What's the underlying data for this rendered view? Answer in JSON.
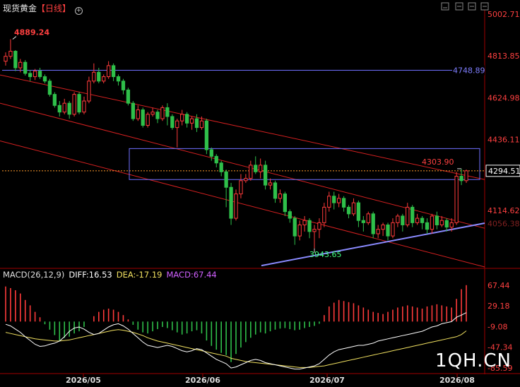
{
  "header": {
    "title": "现货黄金",
    "timeframe": "【日线】",
    "settings_icon": "circle-plus-icon",
    "window_buttons": [
      "minimize-icon",
      "restore-icon",
      "maximize-icon",
      "settings-circle-icon"
    ]
  },
  "colors": {
    "up": "#ff3b3b",
    "down": "#2fbf4a",
    "channel": "#d42020",
    "box": "#6f6fff",
    "support": "#8a8aff",
    "current": "#ff9a2a",
    "diff": "#ffffff",
    "dea": "#f0e060",
    "macd": "#c040ff"
  },
  "price_axis": {
    "ticks": [
      "5002.71",
      "4813.85",
      "4624.98",
      "4436.11",
      "4114.62"
    ],
    "hidden_tick": "4056.38",
    "current_value": "4294.51",
    "level_label": "4748.89"
  },
  "annotations": {
    "high": "4889.24",
    "low": "3943.65",
    "recent_high": "4303.90"
  },
  "x_axis": {
    "labels": [
      "2026/05",
      "2026/06",
      "2026/07",
      "2026/08"
    ]
  },
  "macd": {
    "name": "MACD(26,12,9)",
    "diff_label": "DIFF:16.53",
    "dea_label": "DEA:-17.19",
    "macd_label": "MACD:67.44",
    "ticks": [
      "67.44",
      "29.18",
      "-9.08",
      "-47.34",
      "-85.59"
    ]
  },
  "watermark": "1QH.CN",
  "chart_data": {
    "type": "candlestick",
    "title": "现货黄金【日线】",
    "ylim": [
      3860,
      5002.71
    ],
    "candles": [
      [
        4790,
        4812,
        4770,
        4830
      ],
      [
        4812,
        4835,
        4800,
        4889.24
      ],
      [
        4835,
        4760,
        4745,
        4840
      ],
      [
        4760,
        4785,
        4740,
        4800
      ],
      [
        4785,
        4735,
        4725,
        4795
      ],
      [
        4735,
        4720,
        4700,
        4750
      ],
      [
        4720,
        4745,
        4705,
        4755
      ],
      [
        4745,
        4720,
        4710,
        4760
      ],
      [
        4720,
        4700,
        4690,
        4730
      ],
      [
        4700,
        4640,
        4630,
        4710
      ],
      [
        4640,
        4590,
        4580,
        4650
      ],
      [
        4590,
        4560,
        4540,
        4610
      ],
      [
        4560,
        4600,
        4550,
        4620
      ],
      [
        4600,
        4550,
        4530,
        4610
      ],
      [
        4550,
        4640,
        4540,
        4650
      ],
      [
        4640,
        4560,
        4550,
        4650
      ],
      [
        4560,
        4610,
        4550,
        4630
      ],
      [
        4610,
        4700,
        4600,
        4720
      ],
      [
        4700,
        4740,
        4690,
        4780
      ],
      [
        4740,
        4700,
        4690,
        4760
      ],
      [
        4700,
        4720,
        4690,
        4730
      ],
      [
        4720,
        4770,
        4710,
        4790
      ],
      [
        4770,
        4720,
        4700,
        4780
      ],
      [
        4720,
        4700,
        4680,
        4730
      ],
      [
        4700,
        4660,
        4640,
        4710
      ],
      [
        4660,
        4600,
        4590,
        4670
      ],
      [
        4600,
        4530,
        4520,
        4610
      ],
      [
        4530,
        4570,
        4520,
        4590
      ],
      [
        4570,
        4500,
        4490,
        4580
      ],
      [
        4500,
        4550,
        4490,
        4560
      ],
      [
        4550,
        4560,
        4540,
        4580
      ],
      [
        4560,
        4530,
        4510,
        4570
      ],
      [
        4530,
        4580,
        4520,
        4590
      ],
      [
        4580,
        4540,
        4500,
        4600
      ],
      [
        4540,
        4490,
        4480,
        4550
      ],
      [
        4490,
        4520,
        4400,
        4530
      ],
      [
        4520,
        4550,
        4500,
        4570
      ],
      [
        4550,
        4510,
        4490,
        4560
      ],
      [
        4510,
        4530,
        4480,
        4540
      ],
      [
        4530,
        4490,
        4470,
        4550
      ],
      [
        4490,
        4520,
        4480,
        4540
      ],
      [
        4520,
        4390,
        4370,
        4530
      ],
      [
        4390,
        4360,
        4340,
        4400
      ],
      [
        4360,
        4330,
        4310,
        4370
      ],
      [
        4330,
        4290,
        4270,
        4340
      ],
      [
        4290,
        4220,
        4130,
        4300
      ],
      [
        4220,
        4080,
        4050,
        4240
      ],
      [
        4080,
        4190,
        4070,
        4210
      ],
      [
        4190,
        4250,
        4170,
        4280
      ],
      [
        4250,
        4260,
        4240,
        4280
      ],
      [
        4260,
        4320,
        4250,
        4340
      ],
      [
        4320,
        4290,
        4280,
        4360
      ],
      [
        4290,
        4320,
        4260,
        4350
      ],
      [
        4320,
        4230,
        4210,
        4340
      ],
      [
        4230,
        4240,
        4210,
        4260
      ],
      [
        4240,
        4170,
        4150,
        4250
      ],
      [
        4170,
        4190,
        4150,
        4210
      ],
      [
        4190,
        4110,
        4090,
        4200
      ],
      [
        4110,
        4080,
        4060,
        4120
      ],
      [
        4080,
        4000,
        3960,
        4090
      ],
      [
        4000,
        4050,
        3980,
        4070
      ],
      [
        4050,
        4070,
        4020,
        4090
      ],
      [
        4070,
        4020,
        3990,
        4080
      ],
      [
        4020,
        4030,
        3943.65,
        4050
      ],
      [
        4030,
        4060,
        3990,
        4080
      ],
      [
        4060,
        4130,
        4040,
        4150
      ],
      [
        4130,
        4180,
        4110,
        4200
      ],
      [
        4180,
        4150,
        4120,
        4200
      ],
      [
        4150,
        4170,
        4130,
        4190
      ],
      [
        4170,
        4130,
        4110,
        4180
      ],
      [
        4130,
        4100,
        4080,
        4140
      ],
      [
        4100,
        4150,
        4090,
        4170
      ],
      [
        4150,
        4070,
        4040,
        4160
      ],
      [
        4070,
        4060,
        4020,
        4090
      ],
      [
        4060,
        4100,
        4050,
        4110
      ],
      [
        4100,
        4010,
        3990,
        4110
      ],
      [
        4010,
        4030,
        3990,
        4050
      ],
      [
        4030,
        4050,
        4000,
        4060
      ],
      [
        4050,
        4000,
        3980,
        4060
      ],
      [
        4000,
        4060,
        3990,
        4080
      ],
      [
        4060,
        4090,
        4040,
        4100
      ],
      [
        4090,
        4050,
        4020,
        4100
      ],
      [
        4050,
        4130,
        4040,
        4150
      ],
      [
        4130,
        4060,
        4040,
        4140
      ],
      [
        4060,
        4080,
        4050,
        4100
      ],
      [
        4080,
        4060,
        4030,
        4090
      ],
      [
        4060,
        4030,
        4010,
        4080
      ],
      [
        4030,
        4090,
        4010,
        4100
      ],
      [
        4090,
        4050,
        4030,
        4110
      ],
      [
        4050,
        4070,
        4040,
        4090
      ],
      [
        4070,
        4040,
        4020,
        4080
      ],
      [
        4040,
        4060,
        4020,
        4080
      ],
      [
        4060,
        4270,
        4050,
        4290
      ],
      [
        4270,
        4250,
        4230,
        4303.9
      ],
      [
        4250,
        4294.51,
        4240,
        4300
      ]
    ],
    "lines": {
      "horizontal_level": 4748.89,
      "current_price": 4294.51
    },
    "macd": {
      "ylim": [
        -95,
        75
      ],
      "hist": [
        65,
        62,
        58,
        52,
        40,
        30,
        18,
        8,
        -5,
        -15,
        -25,
        -35,
        -30,
        -28,
        -22,
        -18,
        -10,
        0,
        10,
        18,
        22,
        24,
        22,
        18,
        12,
        4,
        -6,
        -15,
        -20,
        -22,
        -18,
        -14,
        -10,
        -12,
        -16,
        -20,
        -24,
        -22,
        -18,
        -16,
        -22,
        -35,
        -45,
        -52,
        -58,
        -62,
        -75,
        -60,
        -48,
        -38,
        -30,
        -24,
        -20,
        -22,
        -18,
        -15,
        -13,
        -12,
        -14,
        -16,
        -15,
        -12,
        -10,
        -8,
        -4,
        12,
        28,
        35,
        40,
        38,
        36,
        34,
        30,
        26,
        22,
        18,
        16,
        14,
        18,
        22,
        26,
        28,
        30,
        28,
        26,
        24,
        28,
        30,
        32,
        30,
        28,
        26,
        42,
        60,
        67.44
      ],
      "diff": [
        -5,
        -8,
        -14,
        -20,
        -28,
        -35,
        -42,
        -46,
        -45,
        -42,
        -40,
        -36,
        -28,
        -18,
        -12,
        -10,
        -14,
        -20,
        -24,
        -22,
        -16,
        -10,
        -6,
        -4,
        -8,
        -14,
        -22,
        -30,
        -38,
        -44,
        -46,
        -48,
        -46,
        -44,
        -46,
        -50,
        -54,
        -56,
        -54,
        -50,
        -52,
        -58,
        -64,
        -70,
        -74,
        -78,
        -86,
        -84,
        -80,
        -76,
        -72,
        -70,
        -72,
        -76,
        -78,
        -80,
        -82,
        -84,
        -86,
        -88,
        -88,
        -86,
        -84,
        -82,
        -78,
        -70,
        -62,
        -56,
        -52,
        -50,
        -48,
        -46,
        -44,
        -44,
        -42,
        -40,
        -36,
        -34,
        -32,
        -30,
        -28,
        -26,
        -24,
        -22,
        -20,
        -18,
        -14,
        -10,
        -8,
        -4,
        -2,
        0,
        8,
        12,
        16.53
      ],
      "dea": [
        -20,
        -22,
        -24,
        -26,
        -28,
        -30,
        -32,
        -33,
        -34,
        -35,
        -36,
        -36,
        -35,
        -34,
        -32,
        -30,
        -28,
        -26,
        -24,
        -22,
        -20,
        -18,
        -16,
        -15,
        -16,
        -18,
        -20,
        -23,
        -26,
        -30,
        -33,
        -36,
        -38,
        -40,
        -42,
        -44,
        -46,
        -48,
        -50,
        -52,
        -54,
        -56,
        -58,
        -60,
        -62,
        -64,
        -68,
        -70,
        -72,
        -74,
        -75,
        -76,
        -77,
        -78,
        -79,
        -80,
        -81,
        -82,
        -83,
        -84,
        -85,
        -85,
        -85,
        -84,
        -83,
        -82,
        -80,
        -78,
        -76,
        -74,
        -72,
        -70,
        -68,
        -66,
        -64,
        -62,
        -60,
        -58,
        -56,
        -54,
        -52,
        -50,
        -48,
        -46,
        -44,
        -42,
        -40,
        -38,
        -36,
        -34,
        -32,
        -30,
        -28,
        -24,
        -17.19
      ]
    }
  }
}
